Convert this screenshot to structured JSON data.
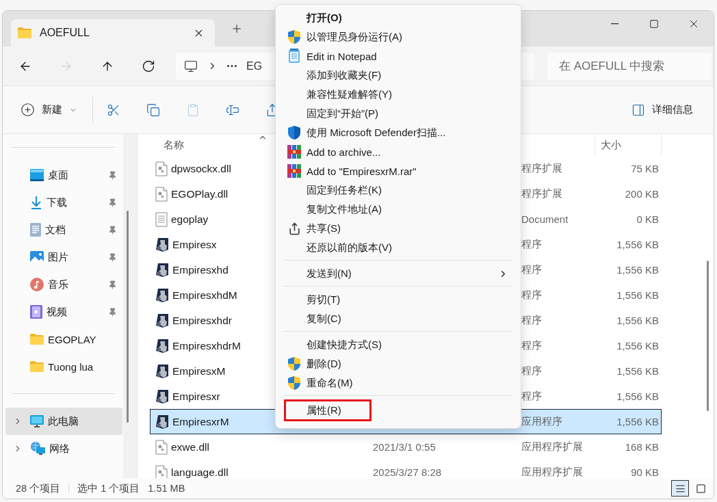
{
  "window": {
    "tab_title": "AOEFULL"
  },
  "nav_buttons": [
    {
      "kind": "back",
      "disabled": false
    },
    {
      "kind": "forward",
      "disabled": true
    },
    {
      "kind": "up",
      "disabled": false
    },
    {
      "kind": "refresh",
      "disabled": false
    }
  ],
  "address_bar": {
    "crumb": "EG"
  },
  "search": {
    "placeholder": "在 AOEFULL 中搜索"
  },
  "toolbar": {
    "new_label": "新建",
    "details_label": "详细信息",
    "buttons": [
      {
        "kind": "cut",
        "disabled": false
      },
      {
        "kind": "copy",
        "disabled": false
      },
      {
        "kind": "paste",
        "disabled": true
      },
      {
        "kind": "rename",
        "disabled": false
      },
      {
        "kind": "share",
        "disabled": false
      }
    ]
  },
  "sidebar": {
    "sections": [
      {
        "items": [
          {
            "label": "桌面",
            "kind": "desktop",
            "pinned": true,
            "expandable": false,
            "selected": false
          },
          {
            "label": "下载",
            "kind": "download",
            "pinned": true,
            "expandable": false,
            "selected": false
          },
          {
            "label": "文档",
            "kind": "documents",
            "pinned": true,
            "expandable": false,
            "selected": false
          },
          {
            "label": "图片",
            "kind": "pictures",
            "pinned": true,
            "expandable": false,
            "selected": false
          },
          {
            "label": "音乐",
            "kind": "music",
            "pinned": true,
            "expandable": false,
            "selected": false
          },
          {
            "label": "视频",
            "kind": "videos",
            "pinned": true,
            "expandable": false,
            "selected": false
          },
          {
            "label": "EGOPLAY",
            "kind": "folder",
            "pinned": false,
            "expandable": false,
            "selected": false
          },
          {
            "label": "Tuong lua",
            "kind": "folder",
            "pinned": false,
            "expandable": false,
            "selected": false
          }
        ]
      },
      {
        "items": [
          {
            "label": "此电脑",
            "kind": "pc",
            "pinned": false,
            "expandable": true,
            "selected": true
          },
          {
            "label": "网络",
            "kind": "network",
            "pinned": false,
            "expandable": true,
            "selected": false
          }
        ]
      }
    ]
  },
  "file_list": {
    "columns": [
      {
        "label": "名称",
        "sorted": true
      },
      {
        "label": "大小"
      }
    ],
    "rows": [
      {
        "name": "dpwsockx.dll",
        "kind": "dll",
        "type": "程序扩展",
        "size": "75 KB",
        "selected": false
      },
      {
        "name": "EGOPlay.dll",
        "kind": "dll",
        "type": "程序扩展",
        "size": "200 KB",
        "selected": false
      },
      {
        "name": "egoplay",
        "kind": "text",
        "type": "Document",
        "size": "0 KB",
        "selected": false
      },
      {
        "name": "Empiresx",
        "kind": "exe",
        "type": "程序",
        "size": "1,556 KB",
        "selected": false
      },
      {
        "name": "Empiresxhd",
        "kind": "exe",
        "type": "程序",
        "size": "1,556 KB",
        "selected": false
      },
      {
        "name": "EmpiresxhdM",
        "kind": "exe",
        "type": "程序",
        "size": "1,556 KB",
        "selected": false
      },
      {
        "name": "Empiresxhdr",
        "kind": "exe",
        "type": "程序",
        "size": "1,556 KB",
        "selected": false
      },
      {
        "name": "EmpiresxhdrM",
        "kind": "exe",
        "type": "程序",
        "size": "1,556 KB",
        "selected": false
      },
      {
        "name": "EmpiresxM",
        "kind": "exe",
        "type": "程序",
        "size": "1,556 KB",
        "selected": false
      },
      {
        "name": "Empiresxr",
        "kind": "exe",
        "type": "程序",
        "size": "1,556 KB",
        "selected": false
      },
      {
        "name": "EmpiresxrM",
        "kind": "exe",
        "type": "应用程序",
        "size": "1,556 KB",
        "selected": true
      },
      {
        "name": "exwe.dll",
        "kind": "dll",
        "date": "2021/3/1 0:55",
        "type": "应用程序扩展",
        "size": "168 KB",
        "selected": false
      },
      {
        "name": "language.dll",
        "kind": "dll",
        "date": "2025/3/27 8:28",
        "type": "应用程序扩展",
        "size": "90 KB",
        "selected": false
      }
    ]
  },
  "status_bar": {
    "count": "28 个项目",
    "selection": "选中 1 个项目",
    "selection_size": "1.51 MB",
    "views": [
      {
        "kind": "details",
        "selected": true
      },
      {
        "kind": "tiles",
        "selected": false
      }
    ]
  },
  "context_menu": {
    "items": [
      {
        "kind": "default",
        "label": "打开(O)",
        "highlighted": false
      },
      {
        "kind": "admin",
        "label": "以管理员身份运行(A)",
        "highlighted": false
      },
      {
        "kind": "notepad",
        "label": "Edit in Notepad",
        "highlighted": false
      },
      {
        "kind": "plain",
        "label": "添加到收藏夹(F)",
        "highlighted": false
      },
      {
        "kind": "plain",
        "label": "兼容性疑难解答(Y)",
        "highlighted": false
      },
      {
        "kind": "plain",
        "label": "固定到“开始”(P)",
        "highlighted": false
      },
      {
        "kind": "scan",
        "label": "使用 Microsoft Defender扫描...",
        "highlighted": false
      },
      {
        "kind": "archive",
        "label": "Add to archive...",
        "highlighted": false
      },
      {
        "kind": "archive",
        "label": "Add to \"EmpiresxrM.rar\"",
        "highlighted": false
      },
      {
        "kind": "plain",
        "label": "固定到任务栏(K)",
        "highlighted": false
      },
      {
        "kind": "plain",
        "label": "复制文件地址(A)",
        "highlighted": false
      },
      {
        "kind": "share",
        "label": "共享(S)",
        "highlighted": false
      },
      {
        "kind": "plain",
        "label": "还原以前的版本(V)",
        "highlighted": false
      },
      {
        "kind": "separator"
      },
      {
        "kind": "submenu",
        "label": "发送到(N)",
        "highlighted": false
      },
      {
        "kind": "separator"
      },
      {
        "kind": "plain",
        "label": "剪切(T)",
        "highlighted": false
      },
      {
        "kind": "plain",
        "label": "复制(C)",
        "highlighted": false
      },
      {
        "kind": "separator"
      },
      {
        "kind": "plain",
        "label": "创建快捷方式(S)",
        "highlighted": false
      },
      {
        "kind": "admin",
        "label": "删除(D)",
        "highlighted": false
      },
      {
        "kind": "admin",
        "label": "重命名(M)",
        "highlighted": false
      },
      {
        "kind": "separator"
      },
      {
        "kind": "plain",
        "label": "属性(R)",
        "highlighted": true
      }
    ]
  }
}
